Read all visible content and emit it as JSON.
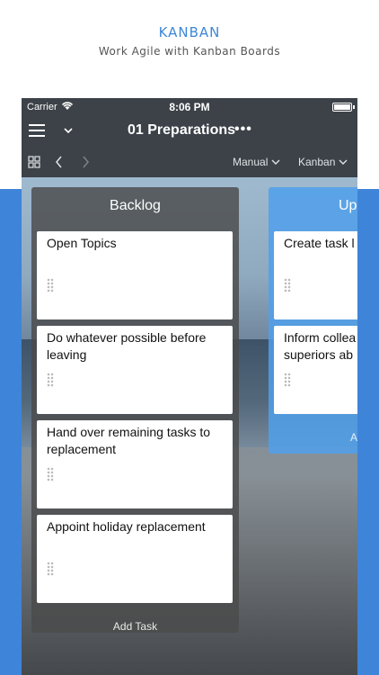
{
  "promo": {
    "title": "KANBAN",
    "subtitle": "Work Agile with Kanban Boards"
  },
  "status_bar": {
    "carrier": "Carrier",
    "time": "8:06 PM"
  },
  "nav": {
    "title": "01 Preparations",
    "more": "•••"
  },
  "toolbar": {
    "sort_label": "Manual",
    "view_label": "Kanban"
  },
  "columns": [
    {
      "title": "Backlog",
      "cards": [
        {
          "text": "Open Topics"
        },
        {
          "text": "Do whatever possible before leaving"
        },
        {
          "text": "Hand over remaining tasks to replacement"
        },
        {
          "text": "Appoint holiday replacement"
        }
      ],
      "add_label": "Add Task"
    },
    {
      "title": "Up",
      "cards": [
        {
          "text": "Create task l"
        },
        {
          "text": "Inform collea superiors ab"
        }
      ],
      "add_label": "A"
    }
  ],
  "colors": {
    "accent": "#3d87d6",
    "bar": "#3c4248",
    "backlog_column": "#4b4b4b",
    "up_column": "#50a0eb"
  },
  "icons": {
    "menu": "hamburger-icon",
    "collapse": "chevron-down-icon",
    "grid": "grid-icon",
    "back": "chevron-left-icon",
    "forward": "chevron-right-icon",
    "wifi": "wifi-icon",
    "battery": "battery-icon",
    "drag": "drag-handle-icon"
  }
}
